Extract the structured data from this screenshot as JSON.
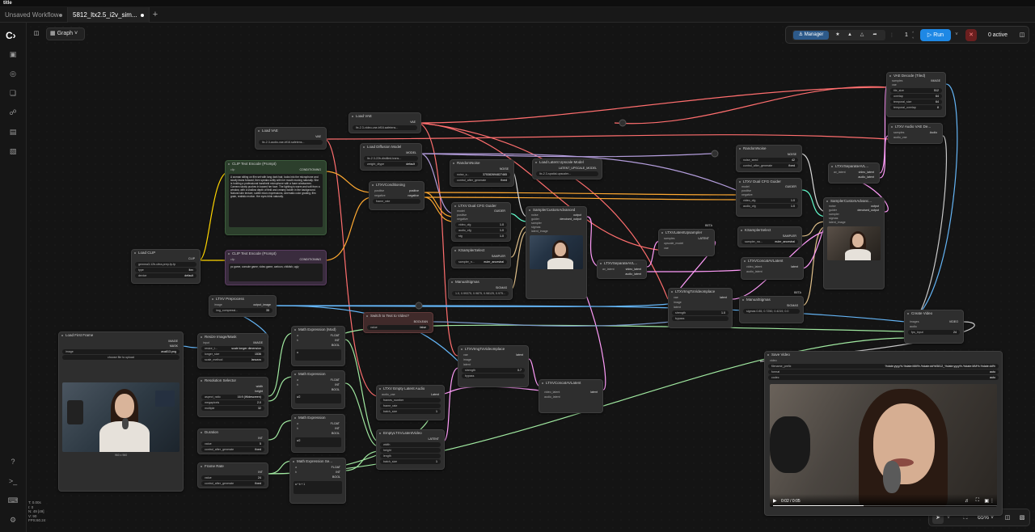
{
  "app": {
    "title": "title"
  },
  "tabs": [
    {
      "label": "Unsaved Workflow"
    },
    {
      "label": "5812_ltx2.5_i2v_sim..."
    }
  ],
  "toolbar": {
    "graph_label": "Graph",
    "manager_label": "Manager",
    "queue_count": "1",
    "run_label": "Run",
    "active_label": "0 active",
    "zoom_label": "65%"
  },
  "stats": [
    "T: 0.00s",
    "I: 0",
    "N: 49 [49]",
    "V: 90",
    "FPS:60.24"
  ],
  "nodes": {
    "load_vae": {
      "title": "Load VAE",
      "out": "VAE",
      "value": "ltx-2.3-video-vae-bf16.safetens..."
    },
    "load_vae2": {
      "title": "Load VAE",
      "out": "VAE",
      "value": "ltx-2.3-audio-vae-bf16.safetens..."
    },
    "load_diffusion": {
      "title": "Load Diffusion Model",
      "out": "MODEL",
      "value": "ltx-2.3-22b-distilled-trans...",
      "dtype_label": "weight_dtype",
      "dtype": "default"
    },
    "clip_pos": {
      "title": "CLIP Text Encode (Prompt)",
      "in": "clip",
      "out": "CONDITIONING",
      "text": "A woman sitting on film set with long dark hair, looks into the microphone and slowly leans forward, then speaks softly with her mouth moving naturally. She is holding a professional handheld microphone with a foam windscreen. Camera slowly pushes in toward her face. The lighting is warm and soft from a window, with a shallow depth of field and creamy bokeh in the background. Natural skin texture, subtle micro expressions, cinematic color grading, film grain, realistic motion. Her eyes blink naturally."
    },
    "clip_neg": {
      "title": "CLIP Text Encode (Prompt)",
      "in": "clip",
      "out": "CONDITIONING",
      "text": "pc game, console game, video game, cartoon, childish, ugly"
    },
    "load_clip": {
      "title": "Load CLIP",
      "out": "CLIP",
      "name": "gemma3-12b-ultra-prep-fp-fp",
      "type_label": "type",
      "type": "ltxv",
      "device_label": "device",
      "device": "default"
    },
    "ltxv_cond": {
      "title": "LTXVConditioning",
      "in1": "positive",
      "in2": "negative",
      "out1": "positive",
      "out2": "negative",
      "fr_label": "frame_rate"
    },
    "random_noise": {
      "title": "RandomNoise",
      "out": "NOISE",
      "seed_label": "noise_s...",
      "seed": "375382694827465",
      "ctrl_label": "control_after_generate",
      "ctrl": "fixed"
    },
    "load_latent_up": {
      "title": "Load Latent Upscale Model",
      "out": "LATENT_UPSCALE_MODEL",
      "value": "ltx-2.3-spatial-upscaler..."
    },
    "guider1": {
      "title": "LTXV Dual CFG Guider",
      "out": "GUIDER",
      "ins": [
        "model",
        "positive",
        "negative"
      ],
      "w1_label": "video_cfg",
      "w1": "1.0",
      "w2_label": "audio_cfg",
      "w2": "1.0",
      "w3_label": "stg",
      "w3": "1.0"
    },
    "ksampler1": {
      "title": "KSamplerSelect",
      "out": "SAMPLER",
      "label": "sampler_n...",
      "value": "euler_ancestral"
    },
    "manual_sigmas1": {
      "title": "ManualSigmas",
      "out": "SIGMAS",
      "value": "1.0, 0.99375, 0.9875, 0.98125, 0.975..."
    },
    "sampler_custom1": {
      "title": "SamplerCustomAdvanced",
      "ins": [
        "noise",
        "guider",
        "sampler",
        "sigmas",
        "latent_image"
      ],
      "out1": "output",
      "out2": "denoised_output"
    },
    "ltxv_preprocess": {
      "title": "LTXV Preprocess",
      "in": "image",
      "out": "output_image",
      "label": "img_compressi...",
      "value": "35"
    },
    "switch": {
      "title": "Switch to Text to Video?",
      "out": "BOOLEAN",
      "label": "value",
      "value": "false"
    },
    "load_image": {
      "title": "Load First Frame",
      "out1": "IMAGE",
      "out2": "MASK",
      "label": "image",
      "value": "ava813.png",
      "upload": "choose file to upload",
      "caption": "960 x 960"
    },
    "resize": {
      "title": "Resize Image/Mask",
      "in": "input",
      "out": "IMAGE",
      "r1_label": "resize_t...",
      "r1": "scale longer dimension",
      "r2_label": "longer_size",
      "r2": "1536",
      "r3_label": "scale_method",
      "r3": "lanczos"
    },
    "res_selector": {
      "title": "Resolution Selector",
      "out1": "width",
      "out2": "height",
      "r1_label": "aspect_ratio",
      "r1": "16:9 (Widescreen)",
      "r2_label": "megapixels",
      "r2": "2.0",
      "r3_label": "multiple",
      "r3": "32"
    },
    "duration": {
      "title": "Duration",
      "out": "INT",
      "r1_label": "value",
      "r1": "5",
      "r2_label": "control_after_generate",
      "r2": "fixed"
    },
    "frame_rate": {
      "title": "Frame Rate",
      "out": "INT",
      "r1_label": "value",
      "r1": "24",
      "r2_label": "control_after_generate",
      "r2": "fixed"
    },
    "math1": {
      "title": "Math Expression (Mod)",
      "ins": [
        "a",
        "b"
      ],
      "outs": [
        "FLOAT",
        "INT",
        "BOOL"
      ],
      "expr": "a"
    },
    "math2": {
      "title": "Math Expression",
      "ins": [
        "a",
        "b"
      ],
      "outs": [
        "FLOAT",
        "INT",
        "BOOL"
      ],
      "expr": "a/2"
    },
    "math3": {
      "title": "Math Expression",
      "ins": [
        "a",
        "b"
      ],
      "outs": [
        "FLOAT",
        "INT",
        "BOOL"
      ],
      "expr": "a/2"
    },
    "math4": {
      "title": "Math Expression Se...",
      "ins": [
        "a",
        "b"
      ],
      "outs": [
        "FLOAT",
        "INT",
        "BOOL"
      ],
      "expr": "a * b + 1"
    },
    "empty_latent_audio": {
      "title": "LTXV Empty Latent Audio",
      "in": "audio_vae",
      "out": "Latent",
      "r1_label": "frames_number",
      "r2_label": "frame_rate",
      "r3_label": "batch_size",
      "r3": "1"
    },
    "empty_ltxv_latent": {
      "title": "EmptyLTXVLatentVideo",
      "out": "LATENT",
      "ins": [
        "width",
        "height",
        "length"
      ],
      "r1_label": "batch_size",
      "r1": "1"
    },
    "ltxv_img_inplace1": {
      "title": "LTXVImgToVideoInplace",
      "ins": [
        "vae",
        "image",
        "latent"
      ],
      "out": "latent",
      "w1_label": "strength",
      "w1": "0.7",
      "w2_label": "bypass"
    },
    "ltxv_concat1": {
      "title": "LTXVConcatAVLatent",
      "ins": [
        "video_latent",
        "audio_latent"
      ],
      "out": "latent"
    },
    "ltxv_separate1": {
      "title": "LTXVSeparateAVL...",
      "in": "av_latent",
      "out1": "video_latent",
      "out2": "audio_latent"
    },
    "latent_upsampler": {
      "title": "LTXVLatentUpsampler",
      "badge": "BETA",
      "ins": [
        "samples",
        "upscale_model",
        "vae"
      ],
      "out": "LATENT"
    },
    "ltxv_img_inplace2": {
      "title": "LTXVImgToVideoInplace",
      "ins": [
        "vae",
        "image",
        "latent"
      ],
      "out": "latent",
      "w1_label": "strength",
      "w1": "1.0",
      "w2_label": "bypass"
    },
    "random_noise2": {
      "title": "RandomNoise",
      "out": "NOISE",
      "r1_label": "noise_seed",
      "r1": "42",
      "r2_label": "control_after_generate",
      "r2": "fixed"
    },
    "guider2": {
      "title": "LTXV Dual CFG Guider",
      "out": "GUIDER",
      "ins": [
        "model",
        "positive",
        "negative"
      ],
      "w1_label": "video_cfg",
      "w1": "1.0",
      "w2_label": "audio_cfg",
      "w2": "1.0"
    },
    "ksampler2": {
      "title": "KSamplerSelect",
      "out": "SAMPLER",
      "label": "sampler_na...",
      "value": "euler_ancestral"
    },
    "ltxv_concat2": {
      "title": "LTXVConcatAVLatent",
      "ins": [
        "video_latent",
        "audio_latent"
      ],
      "out": "latent"
    },
    "manual_sigmas2": {
      "title": "ManualSigmas",
      "badge": "BETA",
      "out": "SIGMAS",
      "label": "sigmas",
      "value": "0.85, 0.7250, 0.4219, 0.0"
    },
    "sampler_custom2": {
      "title": "SamplerCustomAdvanc...",
      "ins": [
        "noise",
        "guider",
        "sampler",
        "sigmas",
        "latent_image"
      ],
      "out1": "output",
      "out2": "denoised_output"
    },
    "ltxv_separate2": {
      "title": "LTXVSeparateAVL...",
      "in": "av_latent",
      "out1": "video_latent",
      "out2": "audio_latent"
    },
    "vae_decode_tiled": {
      "title": "VAE Decode (Tiled)",
      "ins": [
        "samples",
        "vae"
      ],
      "out": "IMAGE",
      "r1_label": "tile_size",
      "r1": "512",
      "r2_label": "overlap",
      "r2": "64",
      "r3_label": "temporal_size",
      "r3": "64",
      "r4_label": "temporal_overlap",
      "r4": "8"
    },
    "audio_vae_decode": {
      "title": "LTXV Audio VAE De...",
      "ins": [
        "samples",
        "audio_vae"
      ],
      "out": "Audio"
    },
    "create_video": {
      "title": "Create Video",
      "ins": [
        "images",
        "audio"
      ],
      "out": "VIDEO",
      "r1_label": "fps_input",
      "r1": "24"
    },
    "save_video": {
      "title": "Save Video",
      "in": "video",
      "r1_label": "filename_prefix",
      "r1": "%date:yyyy%-%date:MM%-%date:dd%/5812_%date:yyyy%-%date:MM%-%date:dd%",
      "r2_label": "format",
      "r2": "auto",
      "r3_label": "codec",
      "r3": "auto",
      "time": "0:02 / 0:05"
    }
  },
  "colors": {
    "vae": "#ff6e6e",
    "model": "#b39ddb",
    "clip": "#ffd500",
    "conditioning": "#ffa931",
    "latent": "#ff9cf9",
    "image": "#64b5f6",
    "int": "#a0e8a0",
    "noise": "#d9d9d9",
    "audio": "#c8c8c8",
    "accent": "#1e88e5"
  }
}
